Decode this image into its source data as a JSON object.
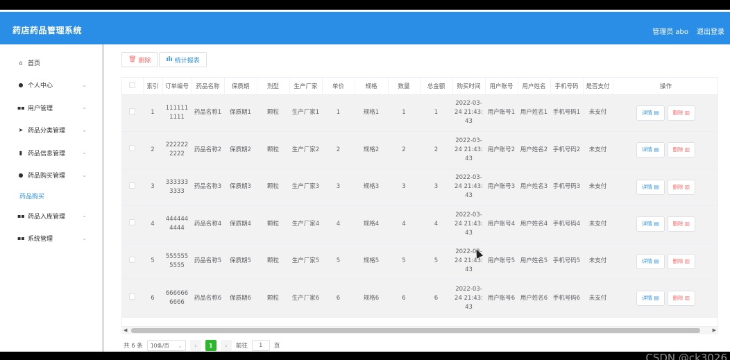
{
  "header": {
    "title": "药店药品管理系统",
    "user": "管理员 abo",
    "logout": "退出登录"
  },
  "sidebar": {
    "items": [
      {
        "icon": "home-icon",
        "label": "首页",
        "chev": false
      },
      {
        "icon": "user-icon",
        "label": "个人中心",
        "chev": true
      },
      {
        "icon": "grid-icon",
        "label": "用户管理",
        "chev": true
      },
      {
        "icon": "send-icon",
        "label": "药品分类管理",
        "chev": true
      },
      {
        "icon": "doc-icon",
        "label": "药品信息管理",
        "chev": true
      },
      {
        "icon": "user-icon",
        "label": "药品购买管理",
        "chev": true
      }
    ],
    "active_sub": "药品购买",
    "items2": [
      {
        "icon": "grid-icon",
        "label": "药品入库管理",
        "chev": true
      },
      {
        "icon": "grid-icon",
        "label": "系统管理",
        "chev": true
      }
    ]
  },
  "toolbar": {
    "delete_label": "删除",
    "report_label": "统计报表"
  },
  "table": {
    "headers": [
      "",
      "索引",
      "订单编号",
      "药品名称",
      "保质期",
      "剂型",
      "生产厂家",
      "单价",
      "规格",
      "数量",
      "总金额",
      "购买时间",
      "用户账号",
      "用户姓名",
      "手机号码",
      "是否支付",
      "操作"
    ],
    "rows": [
      [
        "1",
        "1111111111",
        "药品名称1",
        "保质期1",
        "颗粒",
        "生产厂家1",
        "1",
        "规格1",
        "1",
        "1",
        "2022-03-24 21:43:43",
        "用户账号1",
        "用户姓名1",
        "手机号码1",
        "未支付"
      ],
      [
        "2",
        "2222222222",
        "药品名称2",
        "保质期2",
        "颗粒",
        "生产厂家2",
        "2",
        "规格2",
        "2",
        "2",
        "2022-03-24 21:43:43",
        "用户账号2",
        "用户姓名2",
        "手机号码2",
        "未支付"
      ],
      [
        "3",
        "3333333333",
        "药品名称3",
        "保质期3",
        "颗粒",
        "生产厂家3",
        "3",
        "规格3",
        "3",
        "3",
        "2022-03-24 21:43:43",
        "用户账号3",
        "用户姓名3",
        "手机号码3",
        "未支付"
      ],
      [
        "4",
        "4444444444",
        "药品名称4",
        "保质期4",
        "颗粒",
        "生产厂家4",
        "4",
        "规格4",
        "4",
        "4",
        "2022-03-24 21:43:43",
        "用户账号4",
        "用户姓名4",
        "手机号码4",
        "未支付"
      ],
      [
        "5",
        "5555555555",
        "药品名称5",
        "保质期5",
        "颗粒",
        "生产厂家5",
        "5",
        "规格5",
        "5",
        "5",
        "2022-03-24 21:43:43",
        "用户账号5",
        "用户姓名5",
        "手机号码5",
        "未支付"
      ],
      [
        "6",
        "6666666666",
        "药品名称6",
        "保质期6",
        "颗粒",
        "生产厂家6",
        "6",
        "规格6",
        "6",
        "6",
        "2022-03-24 21:43:43",
        "用户账号6",
        "用户姓名6",
        "手机号码6",
        "未支付"
      ]
    ],
    "detail_label": "详情",
    "delete_label": "删除"
  },
  "pager": {
    "total": "共 6 条",
    "page_size": "10条/页",
    "current": "1",
    "goto": "前往",
    "goto_value": "1",
    "page_unit": "页"
  },
  "watermark": "CSDN @ck3026"
}
